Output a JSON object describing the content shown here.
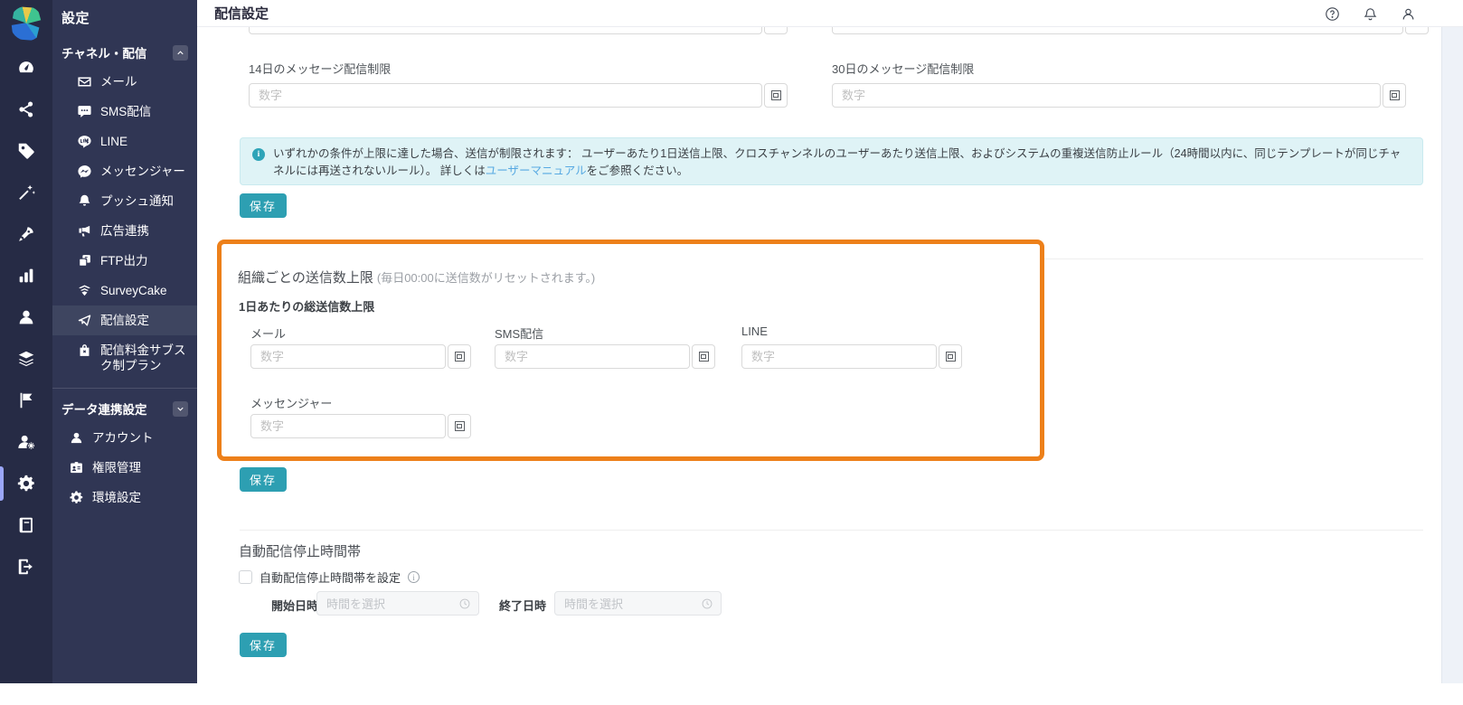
{
  "colors": {
    "accent_teal": "#2d9fb2",
    "highlight_orange": "#ed801a",
    "link_blue": "#57a9e2",
    "rail_bg": "#262b45",
    "sidebar_bg": "#303654",
    "info_bg": "#dff3f6"
  },
  "sidebar": {
    "app_title": "設定",
    "section1": {
      "label": "チャネル・配信",
      "collapse_icon": "chevron-up-icon",
      "items": [
        {
          "icon": "mail-icon",
          "label": "メール"
        },
        {
          "icon": "sms-icon",
          "label": "SMS配信"
        },
        {
          "icon": "line-icon",
          "label": "LINE"
        },
        {
          "icon": "messenger-icon",
          "label": "メッセンジャー"
        },
        {
          "icon": "bell-icon",
          "label": "プッシュ通知"
        },
        {
          "icon": "megaphone-icon",
          "label": "広告連携"
        },
        {
          "icon": "ftp-icon",
          "label": "FTP出力"
        },
        {
          "icon": "surveycake-icon",
          "label": "SurveyCake"
        },
        {
          "icon": "send-icon",
          "label": "配信設定",
          "active": true
        },
        {
          "icon": "bag-lock-icon",
          "label": "配信料金サブスク制プラン"
        }
      ]
    },
    "section2": {
      "label": "データ連携設定",
      "collapse_icon": "chevron-down-icon",
      "items": [
        {
          "icon": "user-icon",
          "label": "アカウント"
        },
        {
          "icon": "idcard-icon",
          "label": "権限管理"
        },
        {
          "icon": "gear-icon",
          "label": "環境設定"
        }
      ]
    }
  },
  "topbar": {
    "title": "配信設定",
    "icons": [
      "help-icon",
      "bell-icon",
      "user-icon"
    ]
  },
  "limits": {
    "label_14": "14日のメッセージ配信制限",
    "label_30": "30日のメッセージ配信制限",
    "number_placeholder": "数字",
    "info_pre": "いずれかの条件が上限に達した場合、送信が制限されます： ユーザーあたり1日送信上限、クロスチャンネルのユーザーあたり送信上限、およびシステムの重複送信防止ルール（24時間以内に、同じテンプレートが同じチャネルには再送されないルール）。 詳しくは",
    "info_link": "ユーザーマニュアル",
    "info_post": "をご参照ください。",
    "save": "保存"
  },
  "org_limits": {
    "title": "組織ごとの送信数上限",
    "title_note": "(毎日00:00に送信数がリセットされます。)",
    "subtitle": "1日あたりの総送信数上限",
    "number_placeholder": "数字",
    "fields": [
      {
        "label": "メール"
      },
      {
        "label": "SMS配信"
      },
      {
        "label": "LINE"
      },
      {
        "label": "メッセンジャー"
      }
    ],
    "save": "保存"
  },
  "quiet_hours": {
    "title": "自動配信停止時間帯",
    "checkbox_label": "自動配信停止時間帯を設定",
    "start_label": "開始日時",
    "end_label": "終了日時",
    "time_placeholder": "時間を選択",
    "save": "保存"
  }
}
